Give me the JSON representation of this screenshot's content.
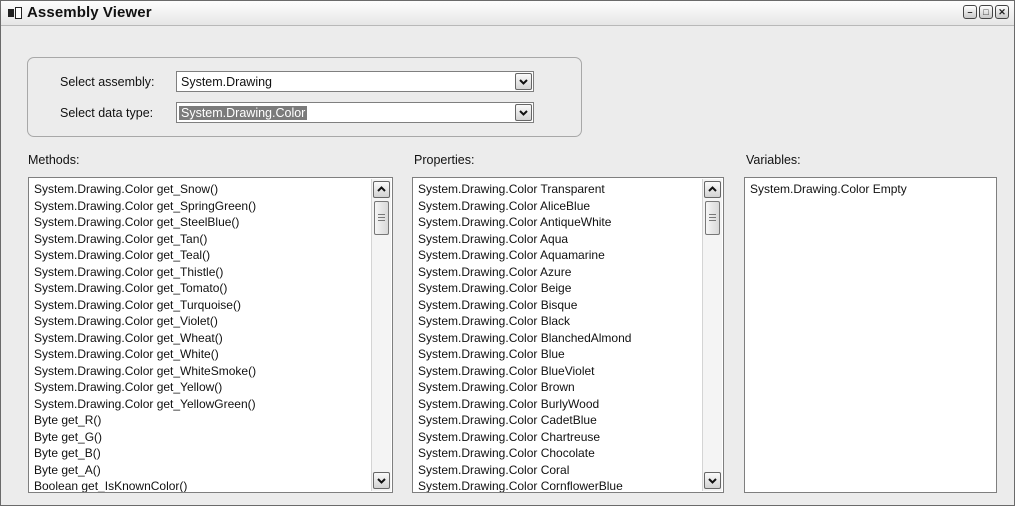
{
  "window": {
    "title": "Assembly Viewer"
  },
  "form": {
    "assembly_label": "Select assembly:",
    "assembly_value": "System.Drawing",
    "datatype_label": "Select data type:",
    "datatype_value": "System.Drawing.Color"
  },
  "methods": {
    "label": "Methods:",
    "items": [
      "System.Drawing.Color get_Snow()",
      "System.Drawing.Color get_SpringGreen()",
      "System.Drawing.Color get_SteelBlue()",
      "System.Drawing.Color get_Tan()",
      "System.Drawing.Color get_Teal()",
      "System.Drawing.Color get_Thistle()",
      "System.Drawing.Color get_Tomato()",
      "System.Drawing.Color get_Turquoise()",
      "System.Drawing.Color get_Violet()",
      "System.Drawing.Color get_Wheat()",
      "System.Drawing.Color get_White()",
      "System.Drawing.Color get_WhiteSmoke()",
      "System.Drawing.Color get_Yellow()",
      "System.Drawing.Color get_YellowGreen()",
      "Byte get_R()",
      "Byte get_G()",
      "Byte get_B()",
      "Byte get_A()",
      "Boolean get_IsKnownColor()"
    ]
  },
  "properties": {
    "label": "Properties:",
    "items": [
      "System.Drawing.Color Transparent",
      "System.Drawing.Color AliceBlue",
      "System.Drawing.Color AntiqueWhite",
      "System.Drawing.Color Aqua",
      "System.Drawing.Color Aquamarine",
      "System.Drawing.Color Azure",
      "System.Drawing.Color Beige",
      "System.Drawing.Color Bisque",
      "System.Drawing.Color Black",
      "System.Drawing.Color BlanchedAlmond",
      "System.Drawing.Color Blue",
      "System.Drawing.Color BlueViolet",
      "System.Drawing.Color Brown",
      "System.Drawing.Color BurlyWood",
      "System.Drawing.Color CadetBlue",
      "System.Drawing.Color Chartreuse",
      "System.Drawing.Color Chocolate",
      "System.Drawing.Color Coral",
      "System.Drawing.Color CornflowerBlue"
    ]
  },
  "variables": {
    "label": "Variables:",
    "items": [
      "System.Drawing.Color Empty"
    ]
  },
  "icons": {
    "app": "app-window-icon",
    "minimize": "minimize-icon",
    "maximize": "maximize-icon",
    "close": "close-icon",
    "dropdown": "chevron-down-icon",
    "scroll_up": "chevron-up-icon",
    "scroll_down": "chevron-down-icon"
  },
  "window_buttons": {
    "minimize": "–",
    "maximize": "□",
    "close": "✕"
  }
}
